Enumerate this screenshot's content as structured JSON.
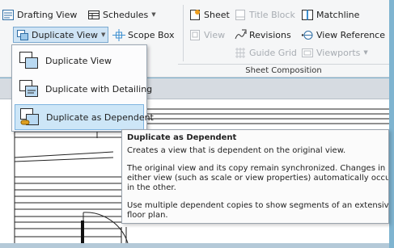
{
  "ribbon": {
    "drafting_view": "Drafting View",
    "schedules": "Schedules",
    "duplicate_view": "Duplicate View",
    "scope_box": "Scope Box",
    "view": "View",
    "sheet": "Sheet",
    "title_block": "Title Block",
    "matchline": "Matchline",
    "revisions": "Revisions",
    "view_reference": "View Reference",
    "guide_grid": "Guide Grid",
    "viewports": "Viewports",
    "sheet_composition": "Sheet Composition"
  },
  "dropdown": {
    "items": [
      {
        "label": "Duplicate View"
      },
      {
        "label": "Duplicate with Detailing"
      },
      {
        "label": "Duplicate as Dependent"
      }
    ]
  },
  "tooltip": {
    "title": "Duplicate as Dependent",
    "line1": "Creates a view that is dependent on the original view.",
    "line2": "The original view and its copy remain synchronized. Changes in",
    "line3": "either view (such as scale or view properties) automatically occur",
    "line4": "in the other.",
    "line5": "Use multiple dependent copies to show segments of an extensive",
    "line6": "floor plan."
  },
  "icons": [
    "drafting-view-icon",
    "schedules-icon",
    "duplicate-view-icon",
    "scope-box-icon",
    "view-icon",
    "sheet-icon",
    "title-block-icon",
    "matchline-icon",
    "revisions-icon",
    "view-reference-icon",
    "guide-grid-icon",
    "viewports-icon",
    "dependent-icon"
  ],
  "colors": {
    "accent": "#3c8fd0",
    "hover": "#cde6f7",
    "background": "#7fb4d0"
  }
}
